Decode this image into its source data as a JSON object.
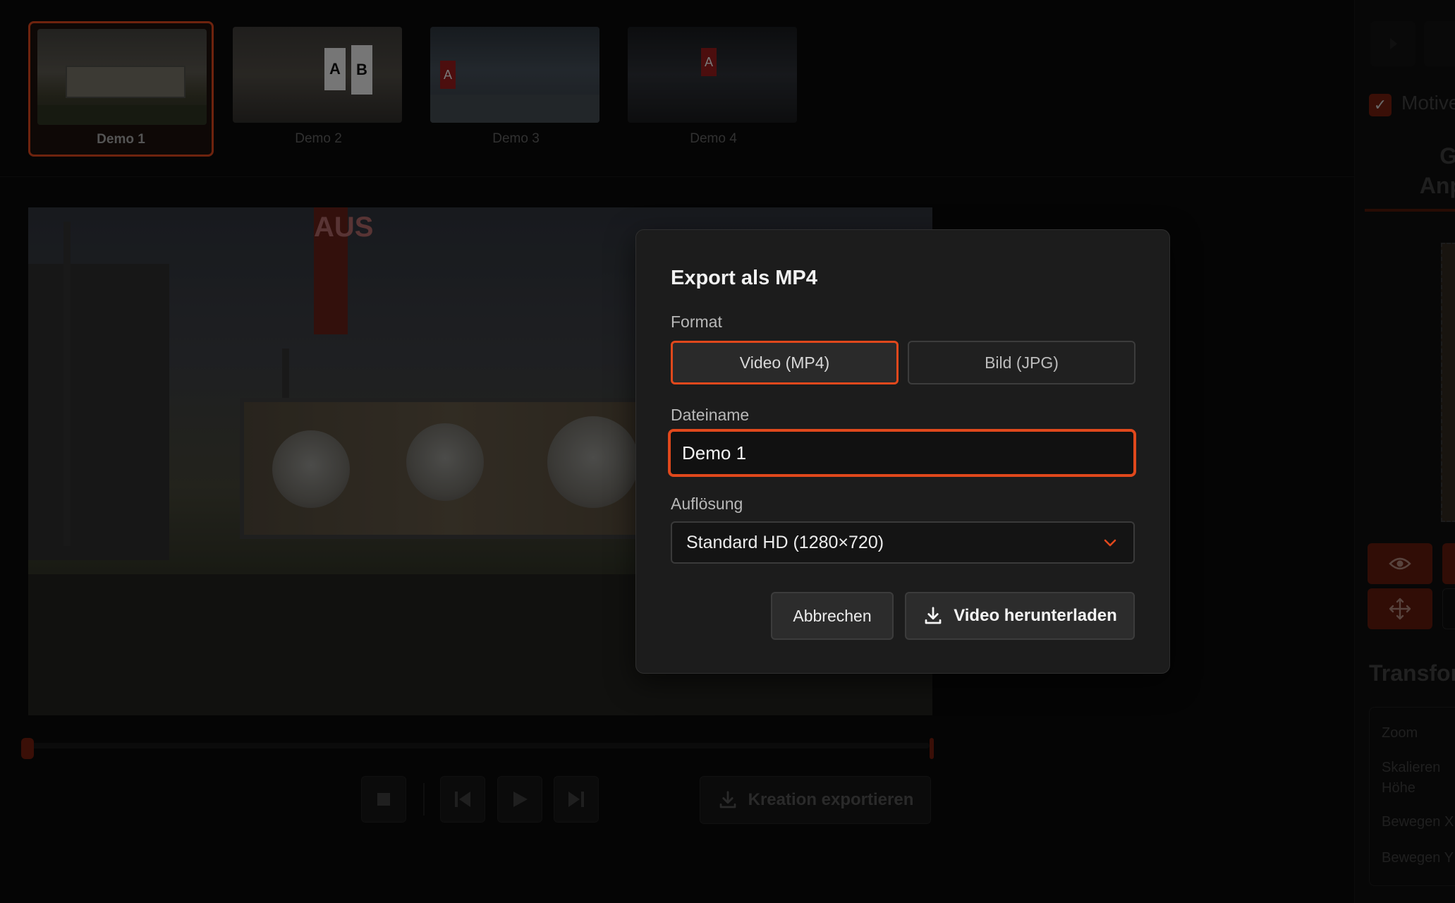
{
  "thumbnails": [
    {
      "label": "Demo 1",
      "active": true
    },
    {
      "label": "Demo 2",
      "active": false
    },
    {
      "label": "Demo 3",
      "active": false
    },
    {
      "label": "Demo 4",
      "active": false
    }
  ],
  "thumb_signs": {
    "a": "A",
    "b": "B"
  },
  "preview": {
    "sign_text": "AUS"
  },
  "toolbar": {
    "export_label": "Kreation exportieren"
  },
  "right_panel": {
    "checkbox_label": "Motive",
    "tab_label_1": "Gl",
    "tab_label_2": "Anp",
    "section_title": "Transfor",
    "fields": [
      "Zoom",
      "Skalieren",
      "Höhe",
      "Bewegen X",
      "Bewegen Y"
    ]
  },
  "modal": {
    "title": "Export als MP4",
    "format_label": "Format",
    "format_options": [
      "Video (MP4)",
      "Bild (JPG)"
    ],
    "selected_format": "Video (MP4)",
    "filename_label": "Dateiname",
    "filename_value": "Demo 1",
    "resolution_label": "Auflösung",
    "resolution_value": "Standard HD (1280×720)",
    "cancel_label": "Abbrechen",
    "download_label": "Video herunterladen"
  },
  "colors": {
    "accent": "#e0481c",
    "background": "#0a0a0a",
    "modal_bg": "#1c1c1c"
  }
}
